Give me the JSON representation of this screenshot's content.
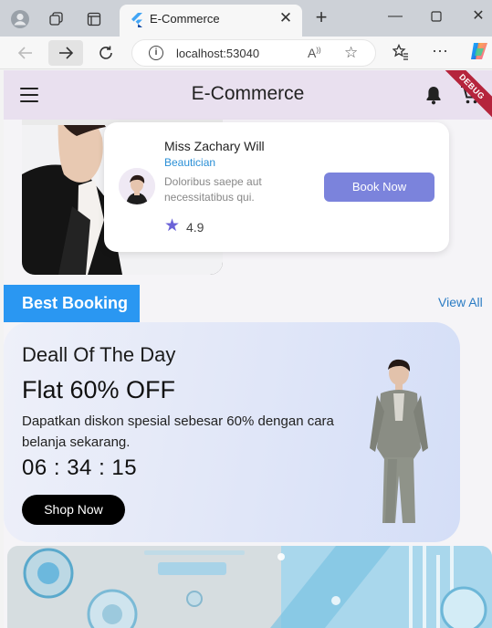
{
  "browser": {
    "tab": {
      "title": "E-Commerce"
    },
    "address": {
      "url": "localhost:53040"
    }
  },
  "app": {
    "title": "E-Commerce",
    "debug_label": "DEBUG",
    "booking_card": {
      "name": "Miss Zachary Will",
      "role": "Beautician",
      "description": "Doloribus saepe aut necessitatibus qui.",
      "rating": "4.9",
      "button_label": "Book Now"
    },
    "section": {
      "title": "Best Booking",
      "view_all_label": "View All"
    },
    "deal": {
      "title": "Deall Of The Day",
      "offer": "Flat 60% OFF",
      "description": "Dapatkan diskon spesial sebesar 60% dengan cara belanja sekarang.",
      "timer": "06 : 34 : 15",
      "button_label": "Shop Now"
    }
  },
  "colors": {
    "app_bar": "#e9e0ef",
    "accent_blue": "#2a97f2",
    "book_button": "#7b83dc",
    "star": "#6b63d8",
    "debug_banner": "#b5243c"
  },
  "icons": [
    "profile-icon",
    "workspaces-icon",
    "tab-actions-icon",
    "flutter-favicon",
    "close-icon",
    "new-tab-icon",
    "minimize-icon",
    "maximize-icon",
    "window-close-icon",
    "back-icon",
    "forward-icon",
    "reload-icon",
    "info-icon",
    "read-aloud-icon",
    "favorite-icon",
    "favorites-icon",
    "more-icon",
    "copilot-icon",
    "menu-icon",
    "notification-bell-icon",
    "shopping-cart-icon",
    "star-icon"
  ]
}
